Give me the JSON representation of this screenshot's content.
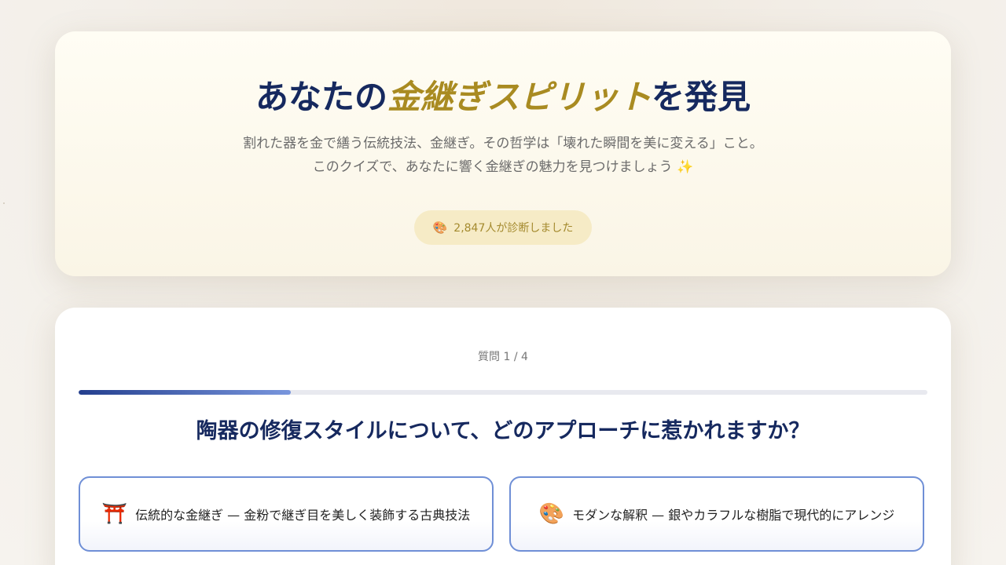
{
  "hero": {
    "title_prefix": "あなたの",
    "title_accent": "金継ぎスピリット",
    "title_suffix": "を発見",
    "description_line1": "割れた器を金で繕う伝統技法、金継ぎ。その哲学は「壊れた瞬間を美に変える」こと。",
    "description_line2": "このクイズで、あなたに響く金継ぎの魅力を見つけましょう ✨",
    "badge_icon": "🎨",
    "badge_text": "2,847人が診断しました"
  },
  "quiz": {
    "counter": "質問 1 / 4",
    "progress": 0.25,
    "question": "陶器の修復スタイルについて、どのアプローチに惹かれますか？",
    "options": [
      {
        "icon": "⛩️",
        "label": "伝統的な金継ぎ — 金粉で継ぎ目を美しく装飾する古典技法"
      },
      {
        "icon": "🎨",
        "label": "モダンな解釈 — 銀やカラフルな樹脂で現代的にアレンジ"
      }
    ]
  },
  "colors": {
    "navy": "#16295f",
    "gold": "#a98b21",
    "option_border": "#6f8fd6",
    "badge_bg": "#f6ebc6"
  }
}
